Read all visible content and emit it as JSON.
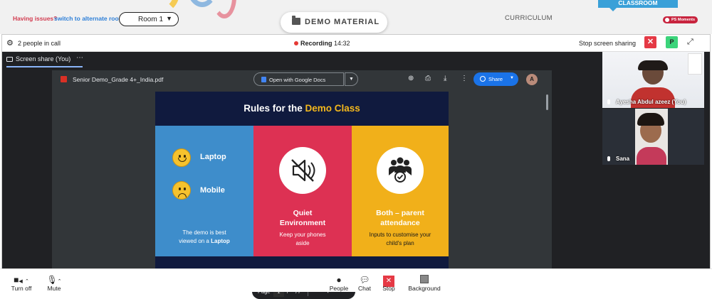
{
  "topbar": {
    "issue_text": "Having issues?",
    "switch_link": "switch to alternate room",
    "room_select_value": "Room 1",
    "demo_material_label": "DEMO MATERIAL",
    "curriculum_label": "CURRICULUM",
    "classroom_tab_label": "CLASSROOM",
    "ps_badge_label": "PS Moments"
  },
  "call": {
    "people_count": "2 people in call",
    "recording_label": "Recording",
    "recording_time": "14:32",
    "stop_share_label": "Stop screen sharing",
    "p_button_label": "P",
    "screen_share_tab": "Screen share (You)"
  },
  "pdf": {
    "filename": "Senior Demo_Grade 4+_India.pdf",
    "open_with_docs": "Open with Google Docs",
    "share_label": "Share",
    "avatar_initial": "A",
    "page_label": "Page",
    "current_page": "1",
    "page_sep": "/",
    "total_pages": "77"
  },
  "slide": {
    "title_prefix": "Rules for the",
    "title_accent": "Demo Class",
    "laptop_label": "Laptop",
    "mobile_label": "Mobile",
    "blue_text_1": "The demo is best",
    "blue_text_2": "viewed on a",
    "blue_text_bold": "Laptop",
    "quiet_head_1": "Quiet",
    "quiet_head_2": "Environment",
    "quiet_text_1": "Keep your phones",
    "quiet_text_2": "aside",
    "parent_head_1": "Both – parent",
    "parent_head_2": "attendance",
    "parent_text_1": "Inputs to customise your",
    "parent_text_2": "child's plan"
  },
  "participants": [
    {
      "name": "Ayesha Abdul azeez (You)"
    },
    {
      "name": "Sana"
    }
  ],
  "controls": [
    {
      "label": "Turn off",
      "icon": "camera-icon"
    },
    {
      "label": "Mute",
      "icon": "microphone-icon"
    },
    {
      "label": "People",
      "icon": "people-icon"
    },
    {
      "label": "Chat",
      "icon": "chat-icon"
    },
    {
      "label": "Stop",
      "icon": "stop-share-icon"
    },
    {
      "label": "Background",
      "icon": "background-icon"
    }
  ],
  "colors": {
    "accent_blue": "#1a73e8",
    "alert_red": "#e53945",
    "slide_blue": "#3e8dcb",
    "slide_red": "#dd3153",
    "slide_yellow": "#f1b01a",
    "slide_navy": "#101a3e"
  }
}
